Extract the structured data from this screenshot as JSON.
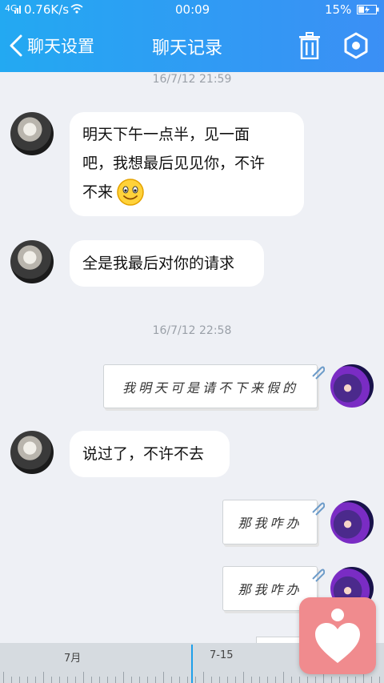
{
  "status_bar": {
    "signal": "4G",
    "speed": "0.76K/s",
    "time": "00:09",
    "battery": "15%"
  },
  "header": {
    "back_label": "聊天设置",
    "title": "聊天记录"
  },
  "messages": [
    {
      "type": "time",
      "text": "16/7/12 21:59"
    },
    {
      "type": "incoming",
      "text_line1": "明天下午一点半，见一面",
      "text_line2": "吧，我想最后见见你，不许",
      "text_line3": "不来",
      "emoji": "smile"
    },
    {
      "type": "incoming",
      "text": "全是我最后对你的请求"
    },
    {
      "type": "time",
      "text": "16/7/12 22:58"
    },
    {
      "type": "outgoing-paper",
      "text": "我明天可是请不下来假的"
    },
    {
      "type": "incoming",
      "text": "说过了，不许不去"
    },
    {
      "type": "outgoing-paper",
      "text": "那我咋办"
    },
    {
      "type": "outgoing-paper",
      "text": "那我咋办"
    }
  ],
  "timeline": {
    "label_month": "7月",
    "label_date": "7-15"
  },
  "colors": {
    "header_start": "#23a9f2",
    "header_end": "#3b8ff5",
    "background": "#eef0f5",
    "accent": "#1fa0ea",
    "fab": "#f08b8e"
  }
}
